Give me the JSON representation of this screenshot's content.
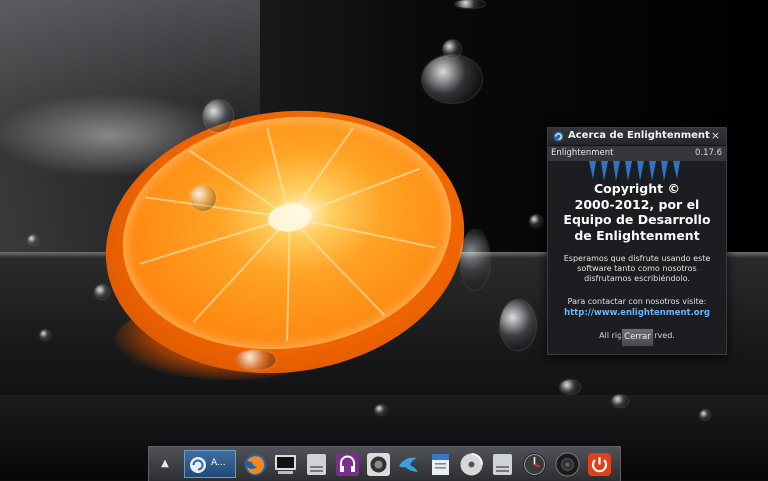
{
  "window": {
    "title": "Acerca de Enlightenment",
    "close_symbol": "×",
    "app_name": "Enlightenment",
    "version": "0.17.6",
    "copyright_lines": [
      "Copyright ©",
      "2000-2012, por el",
      "Equipo de Desarrollo",
      "de  Enlightenment"
    ],
    "hope_lines": [
      "Esperamos que disfrute usando este",
      "software tanto como nosotros",
      "disfrutamos escribiéndolo."
    ],
    "contact_text": "Para contactar con nosotros visite:",
    "contact_url": "http://www.enlightenment.org",
    "rights_text": "All rights reserved.",
    "close_button_label": "Cerrar"
  },
  "shelf": {
    "up_arrow": "▲",
    "task": {
      "label": "A...",
      "icon": "enlightenment-icon"
    },
    "launchers": [
      {
        "name": "firefox-icon"
      },
      {
        "name": "terminal-icon"
      },
      {
        "name": "drive-icon"
      },
      {
        "name": "headphones-icon"
      },
      {
        "name": "camera-lens-icon"
      },
      {
        "name": "bird-icon"
      },
      {
        "name": "document-icon"
      },
      {
        "name": "disc-icon"
      },
      {
        "name": "drive-icon"
      },
      {
        "name": "clock-icon"
      },
      {
        "name": "speaker-icon"
      },
      {
        "name": "power-icon"
      }
    ]
  },
  "colors": {
    "link": "#66b6ff",
    "accent": "#2f6aa6",
    "power": "#e0401a",
    "orange": "#ff8a12"
  }
}
